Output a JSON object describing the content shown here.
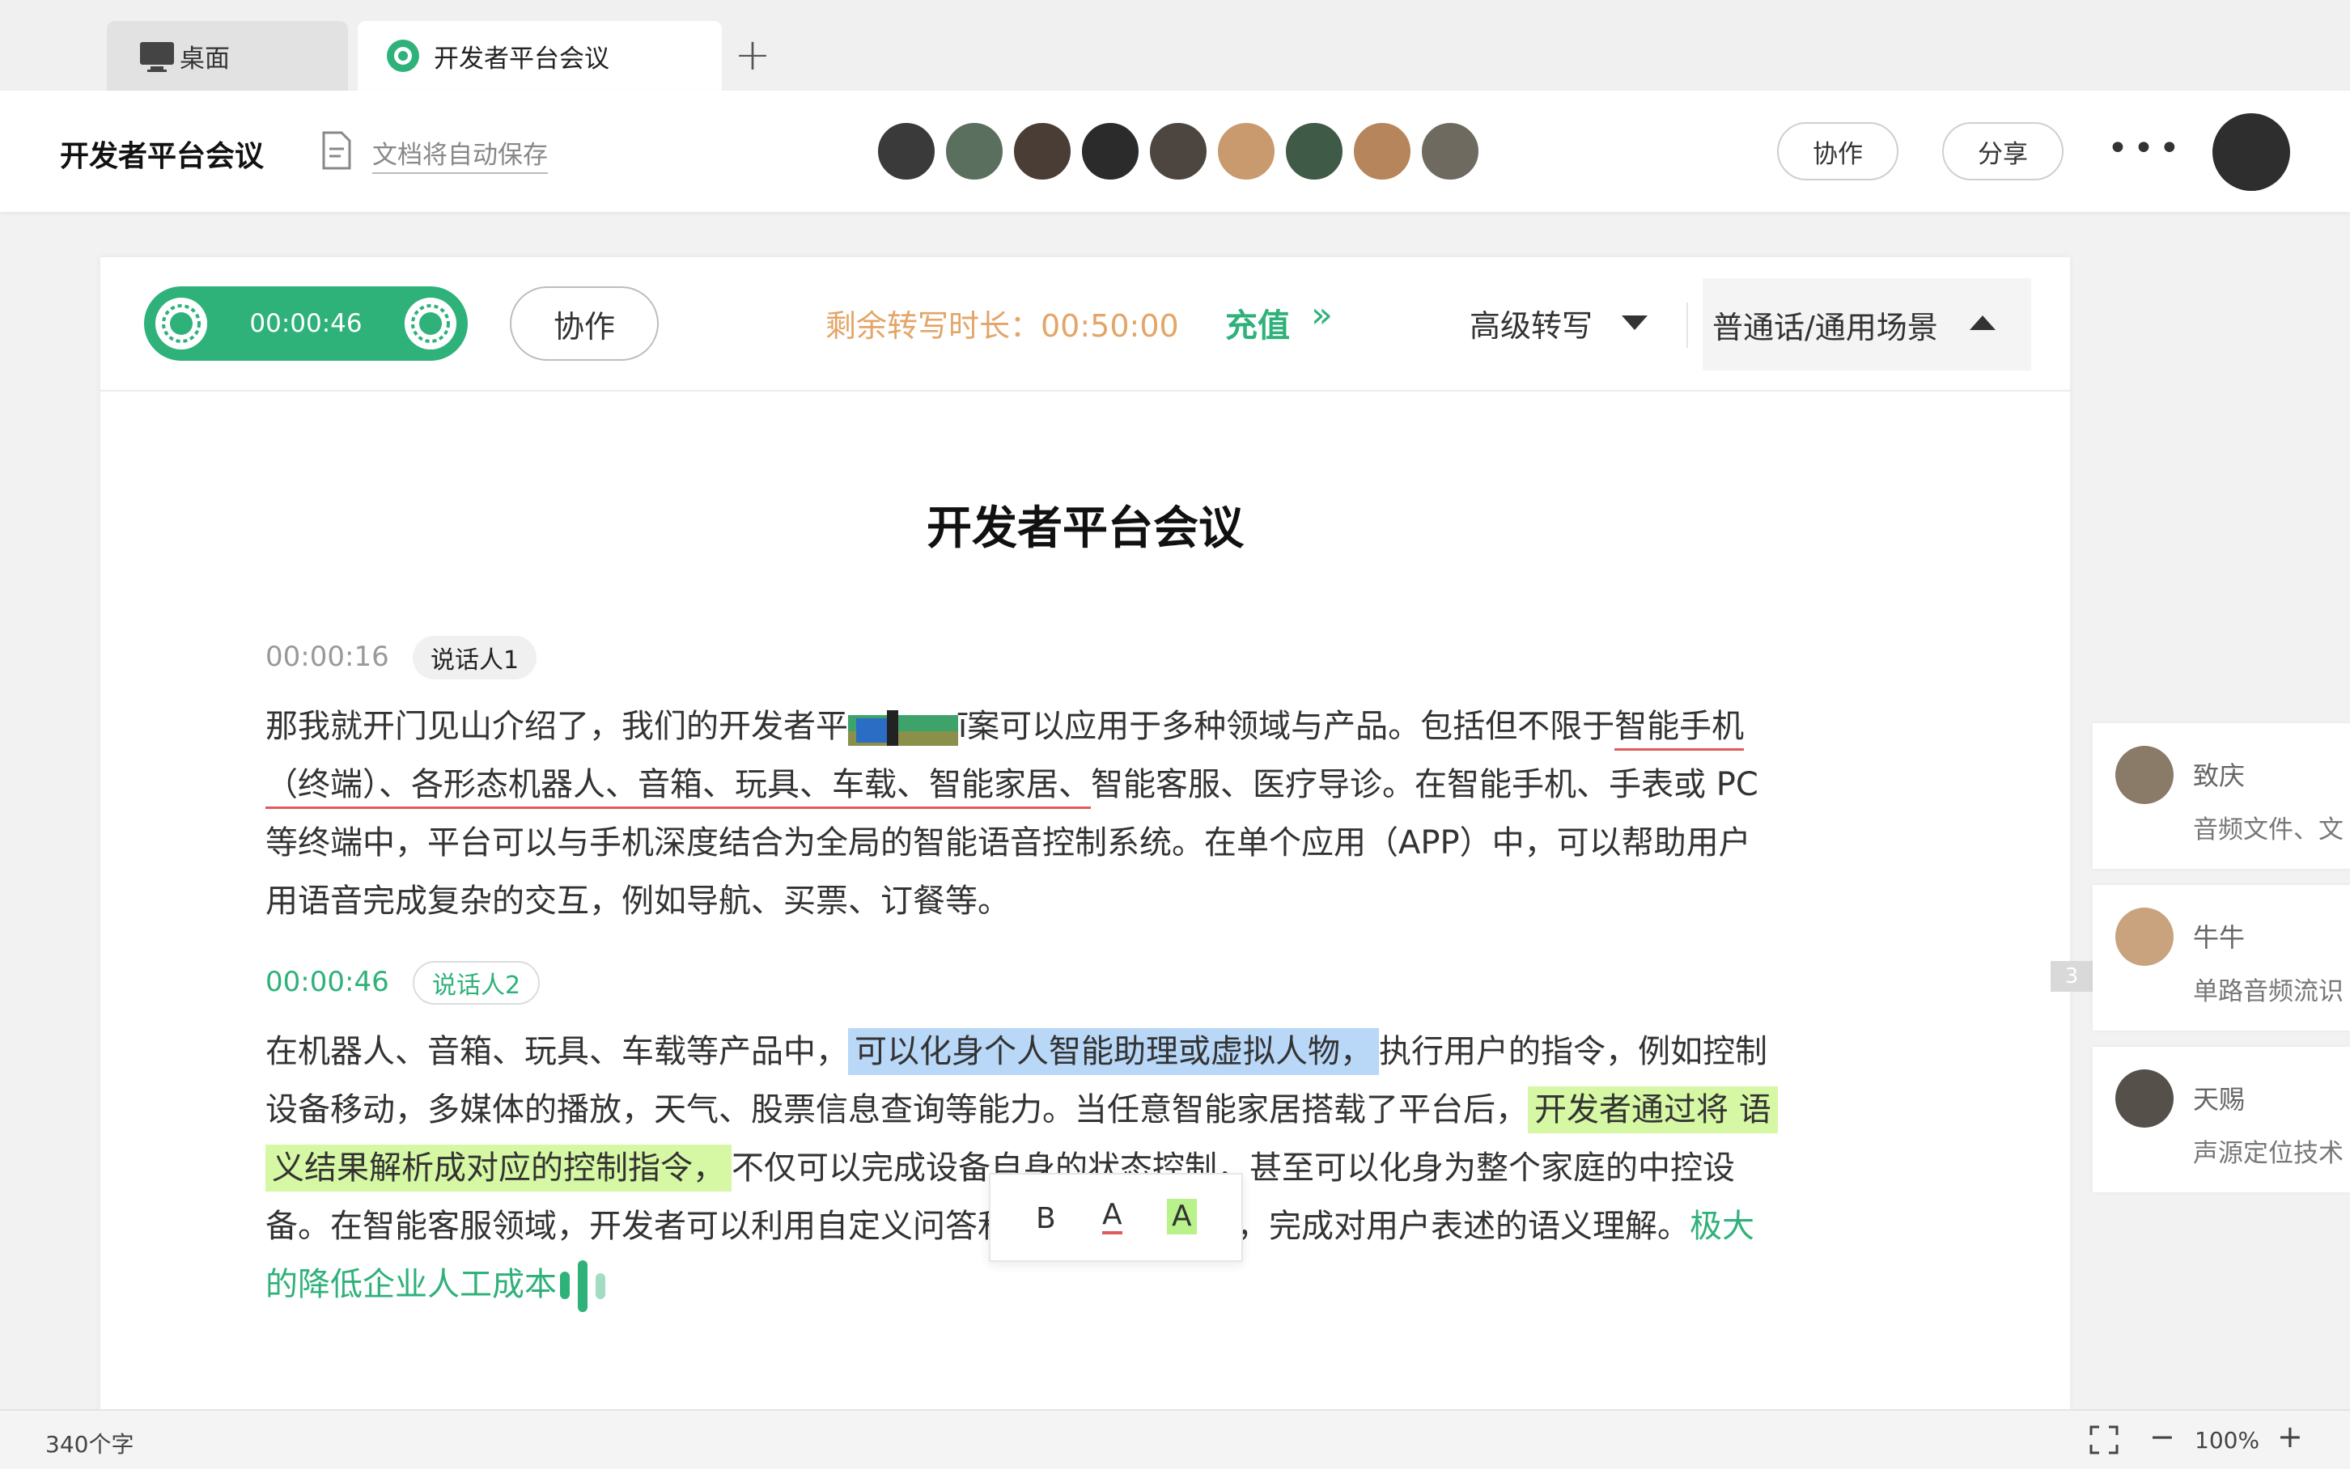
{
  "tabs": [
    {
      "label": "桌面"
    },
    {
      "label": "开发者平台会议"
    }
  ],
  "header": {
    "title": "开发者平台会议",
    "save_status": "文档将自动保存",
    "collab_label": "协作",
    "share_label": "分享",
    "more_label": "•••"
  },
  "toolbar": {
    "record_time": "00:00:46",
    "collab_label": "协作",
    "remaining": "剩余转写时长：00:50:00",
    "recharge": "充值",
    "recharge_arrow": "»",
    "mode": "高级转写",
    "scene": "普通话/通用场景"
  },
  "document": {
    "title": "开发者平台会议",
    "segments": [
      {
        "time": "00:00:16",
        "speaker": "说话人1",
        "lines": [
          {
            "a": "那我就开门见山介绍了，我们的开发者平",
            "b": "ī案可以应用于多种领域与产品。包括但不限于",
            "c": "智能手机"
          },
          {
            "a": "（终端）、各形态机器人、音箱、玩具、车载、智能家居、",
            "b": "智能客服、医疗导诊。在智能手机、手表或 PC"
          },
          {
            "a": "等终端中，平台可以与手机深度结合为全局的智能语音控制系统。在单个应用（APP）中，可以帮助用户"
          },
          {
            "a": "用语音完成复杂的交互，例如导航、买票、订餐等。"
          }
        ]
      },
      {
        "time": "00:00:46",
        "speaker": "说话人2",
        "lines": [
          {
            "a": "在机器人、音箱、玩具、车载等产品中，",
            "b": "可以化身个人智能助理或虚拟人物，",
            "c": "执行用户的指令，例如控制"
          },
          {
            "a": "设备移动，多媒体的播放，天气、股票信息查询等能力。当任意智能家居搭载了平台后，",
            "b": "开发者通过将 语"
          },
          {
            "a": "义结果解析成对应的控制指令，",
            "b": "不仅可以完成设备自身的状态控制，甚至可以化身为整个家庭的中控设"
          },
          {
            "a": "备。在智能客服领域，开发者可以利用自定义问答和自定义技能能力，完成对用户表述的语义理解。",
            "b": "极大"
          },
          {
            "a": "的降低企业人工成本"
          }
        ]
      }
    ],
    "comment_count": "3"
  },
  "format_popup": {
    "bold": "B",
    "color": "A",
    "highlight": "A"
  },
  "comments": [
    {
      "name": "致庆",
      "text": "音频文件、文"
    },
    {
      "name": "牛牛",
      "text": "单路音频流识"
    },
    {
      "name": "天赐",
      "text": "声源定位技术"
    }
  ],
  "status": {
    "word_count": "340个字",
    "zoom": "100%",
    "zoom_minus": "−",
    "zoom_plus": "+"
  },
  "colors": {
    "accent": "#2fb17a",
    "warning": "#e3a568",
    "underline": "#e2595b",
    "highlight_blue": "#b9d7f7",
    "highlight_green": "#d6f7a3"
  },
  "avatar_colors": [
    "#3a3a3a",
    "#5b6f5e",
    "#4a3d36",
    "#2b2b2b",
    "#4d4640",
    "#c89a6e",
    "#3f5a46",
    "#b7855c",
    "#6e6a60"
  ]
}
